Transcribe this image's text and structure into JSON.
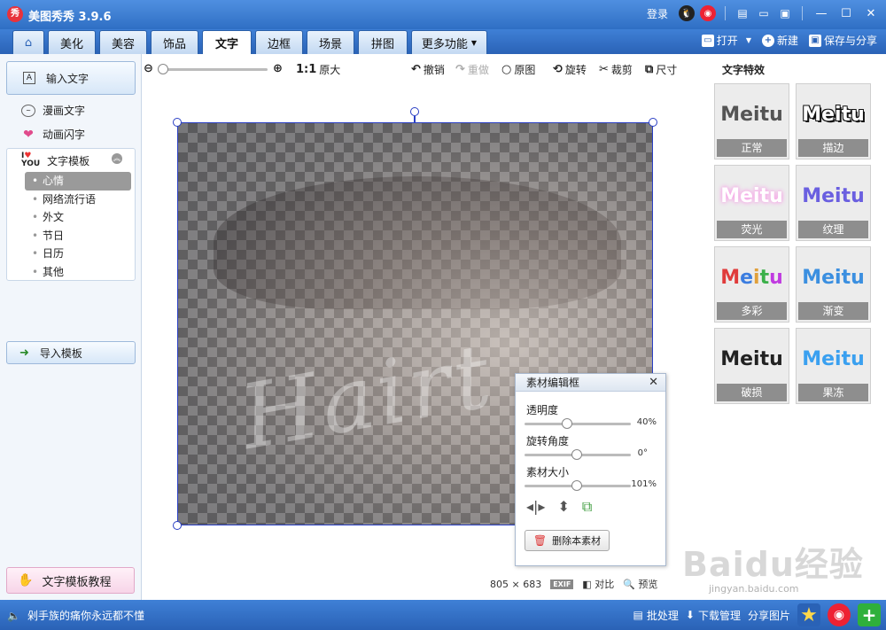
{
  "title_bar": {
    "logo": "秀",
    "app_title": "美图秀秀 3.9.6",
    "login": "登录",
    "icons": [
      "qq-icon",
      "weibo-icon",
      "skin-icon",
      "feedback-icon",
      "menu-icon"
    ],
    "window_buttons": [
      "minimize-icon",
      "maximize-icon",
      "close-icon"
    ]
  },
  "tabs": {
    "items": [
      {
        "label": "美化"
      },
      {
        "label": "美容"
      },
      {
        "label": "饰品"
      },
      {
        "label": "文字"
      },
      {
        "label": "边框"
      },
      {
        "label": "场景"
      },
      {
        "label": "拼图"
      },
      {
        "label": "更多功能"
      }
    ],
    "active": "文字",
    "open": "打开",
    "new": "新建",
    "save_share": "保存与分享"
  },
  "left_panel": {
    "input_text": "输入文字",
    "comic_text": "漫画文字",
    "anim_text": "动画闪字",
    "template_header": "文字模板",
    "template_items": [
      "心情",
      "网络流行语",
      "外文",
      "节日",
      "日历",
      "其他"
    ],
    "selected_template": "心情",
    "import_template": "导入模板",
    "tutorial": "文字模板教程"
  },
  "toolbar": {
    "ratio": "1:1",
    "original_size": "原大",
    "undo": "撤销",
    "redo": "重做",
    "original": "原图",
    "rotate": "旋转",
    "crop": "裁剪",
    "size": "尺寸"
  },
  "canvas": {
    "overlay_text": "Hairt"
  },
  "material_dialog": {
    "title": "素材编辑框",
    "opacity_label": "透明度",
    "opacity_value": "40%",
    "rotation_label": "旋转角度",
    "rotation_value": "0°",
    "size_label": "素材大小",
    "size_value": "101%",
    "delete_button": "删除本素材"
  },
  "text_effects": {
    "title": "文字特效",
    "sample_word": "Meitu",
    "items": [
      {
        "label": "正常",
        "color": "#555555"
      },
      {
        "label": "描边",
        "color": "#111111"
      },
      {
        "label": "荧光",
        "color": "#f7a7e8"
      },
      {
        "label": "纹理",
        "color": "#6a5fe0"
      },
      {
        "label": "多彩",
        "color": "#e03b3b"
      },
      {
        "label": "渐变",
        "color": "#3b8fe0"
      },
      {
        "label": "破损",
        "color": "#222222"
      },
      {
        "label": "果冻",
        "color": "#3aa0f0"
      }
    ]
  },
  "image_info": {
    "width": "805",
    "times": "×",
    "height": "683",
    "exif": "EXIF",
    "compare": "对比",
    "preview": "预览"
  },
  "watermark": {
    "brand": "Baidu经验",
    "url": "jingyan.baidu.com"
  },
  "status_bar": {
    "message": "剁手族的痛你永远都不懂",
    "batch": "批处理",
    "download": "下载管理",
    "share": "分享图片"
  }
}
